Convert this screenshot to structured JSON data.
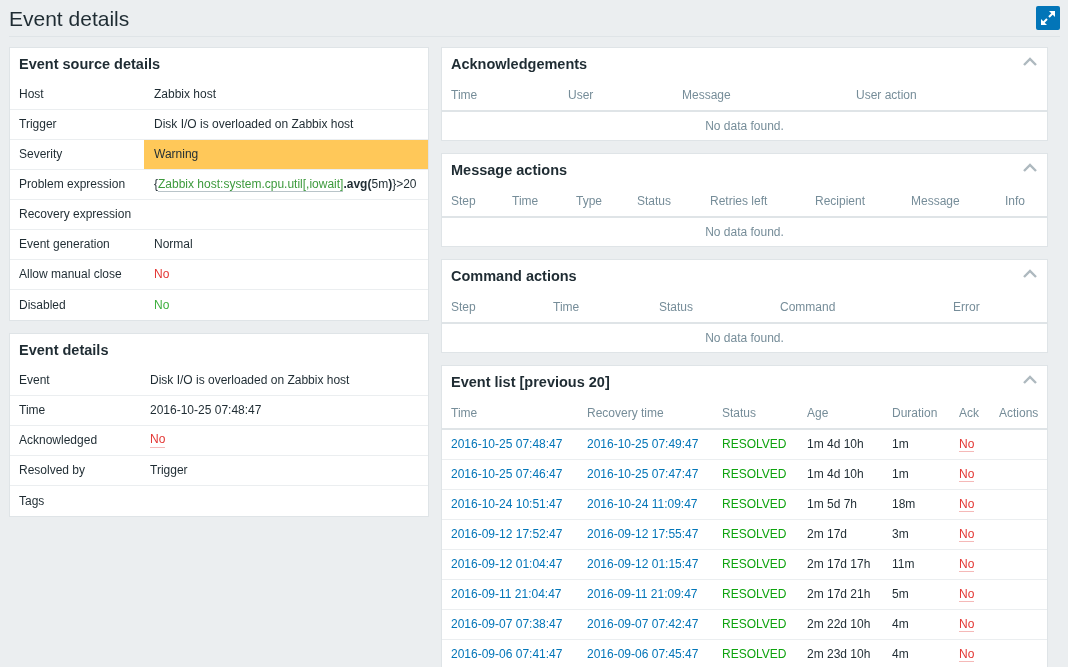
{
  "page": {
    "title": "Event details"
  },
  "event_source_details": {
    "title": "Event source details",
    "rows": [
      {
        "label": "Host",
        "kind": "text",
        "value": "Zabbix host"
      },
      {
        "label": "Trigger",
        "kind": "text",
        "value": "Disk I/O is overloaded on Zabbix host"
      },
      {
        "label": "Severity",
        "kind": "severity",
        "value": "Warning",
        "color": "#ffc859"
      },
      {
        "label": "Problem expression",
        "kind": "expression",
        "prefix": "{",
        "link": "Zabbix host:system.cpu.util[,iowait]",
        "suffix": "**.avg(**5m**)**}>20"
      },
      {
        "label": "Recovery expression",
        "kind": "text"
      },
      {
        "label": "Event generation",
        "kind": "text",
        "value": "Normal"
      },
      {
        "label": "Allow manual close",
        "kind": "flag",
        "value": "No",
        "color": "#e33734"
      },
      {
        "label": "Disabled",
        "kind": "flag",
        "value": "No",
        "color": "#3daf3d"
      }
    ]
  },
  "event_details": {
    "title": "Event details",
    "rows": [
      {
        "label": "Event",
        "kind": "text",
        "value": "Disk I/O is overloaded on Zabbix host"
      },
      {
        "label": "Time",
        "kind": "text",
        "value": "2016-10-25 07:48:47"
      },
      {
        "label": "Acknowledged",
        "kind": "link",
        "value": "No",
        "color": "#e33734"
      },
      {
        "label": "Resolved by",
        "kind": "text",
        "value": "Trigger"
      },
      {
        "label": "Tags",
        "kind": "text"
      }
    ]
  },
  "panels": [
    {
      "title": "Acknowledgements",
      "expanded": true,
      "columns": [
        "Time",
        "User",
        "Message",
        "User action"
      ],
      "empty_text": "No data found."
    },
    {
      "title": "Message actions",
      "expanded": true,
      "columns": [
        "Step",
        "Time",
        "Type",
        "Status",
        "Retries left",
        "Recipient",
        "Message",
        "Info"
      ],
      "empty_text": "No data found."
    },
    {
      "title": "Command actions",
      "expanded": true,
      "columns": [
        "Step",
        "Time",
        "Status",
        "Command",
        "Error"
      ],
      "empty_text": "No data found."
    },
    {
      "title": "Event list [previous 20]",
      "expanded": true,
      "columns": [
        "Time",
        "Recovery time",
        "Status",
        "Age",
        "Duration",
        "Ack",
        "Actions"
      ],
      "rows": [
        {
          "time": "2016-10-25 07:48:47",
          "recovery_time": "2016-10-25 07:49:47",
          "status": "RESOLVED",
          "age": "1m 4d 10h",
          "duration": "1m",
          "ack": "No"
        },
        {
          "time": "2016-10-25 07:46:47",
          "recovery_time": "2016-10-25 07:47:47",
          "status": "RESOLVED",
          "age": "1m 4d 10h",
          "duration": "1m",
          "ack": "No"
        },
        {
          "time": "2016-10-24 10:51:47",
          "recovery_time": "2016-10-24 11:09:47",
          "status": "RESOLVED",
          "age": "1m 5d 7h",
          "duration": "18m",
          "ack": "No"
        },
        {
          "time": "2016-09-12 17:52:47",
          "recovery_time": "2016-09-12 17:55:47",
          "status": "RESOLVED",
          "age": "2m 17d",
          "duration": "3m",
          "ack": "No"
        },
        {
          "time": "2016-09-12 01:04:47",
          "recovery_time": "2016-09-12 01:15:47",
          "status": "RESOLVED",
          "age": "2m 17d 17h",
          "duration": "11m",
          "ack": "No"
        },
        {
          "time": "2016-09-11 21:04:47",
          "recovery_time": "2016-09-11 21:09:47",
          "status": "RESOLVED",
          "age": "2m 17d 21h",
          "duration": "5m",
          "ack": "No"
        },
        {
          "time": "2016-09-07 07:38:47",
          "recovery_time": "2016-09-07 07:42:47",
          "status": "RESOLVED",
          "age": "2m 22d 10h",
          "duration": "4m",
          "ack": "No"
        },
        {
          "time": "2016-09-06 07:41:47",
          "recovery_time": "2016-09-06 07:45:47",
          "status": "RESOLVED",
          "age": "2m 23d 10h",
          "duration": "4m",
          "ack": "No"
        }
      ]
    }
  ]
}
